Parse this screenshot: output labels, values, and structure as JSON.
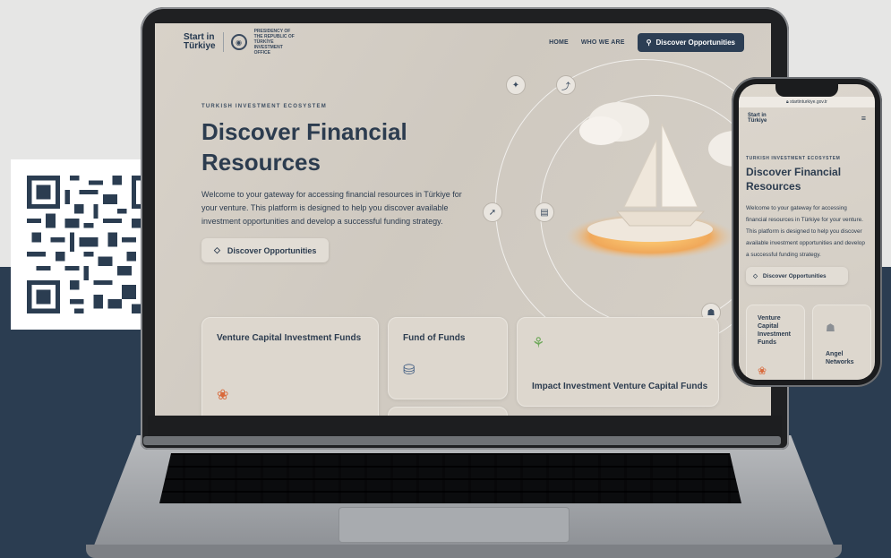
{
  "laptop_site": {
    "nav": {
      "logo_line1": "Start in",
      "logo_line2": "Türkiye",
      "office_line1": "PRESIDENCY OF THE REPUBLIC OF TÜRKİYE",
      "office_line2": "INVESTMENT OFFICE",
      "links": [
        "HOME",
        "WHO WE ARE"
      ],
      "cta_label": "Discover Opportunities"
    },
    "hero": {
      "eyebrow": "TURKISH INVESTMENT ECOSYSTEM",
      "title": "Discover Financial Resources",
      "description": "Welcome to your gateway for accessing financial resources in Türkiye for your venture. This platform is designed to help you discover available investment opportunities and develop a successful funding strategy.",
      "button_label": "Discover Opportunities"
    },
    "cards": [
      {
        "title": "Venture Capital Investment Funds",
        "icon": "handshake-icon"
      },
      {
        "title": "Fund of Funds",
        "icon": "coins-hand-icon"
      },
      {
        "title": "Impact Investment Venture Capital Funds",
        "icon": "sprout-icon"
      }
    ]
  },
  "phone_site": {
    "url": "startinturkiye.gov.tr",
    "logo_line1": "Start in",
    "logo_line2": "Türkiye",
    "eyebrow": "TURKISH INVESTMENT ECOSYSTEM",
    "title": "Discover Financial Resources",
    "description": "Welcome to your gateway for accessing financial resources in Türkiye for your venture. This platform is designed to help you discover available investment opportunities and develop a successful funding strategy.",
    "button_label": "Discover Opportunities",
    "cards": [
      {
        "title": "Venture Capital Investment Funds"
      },
      {
        "title": "Angel Networks"
      }
    ]
  },
  "colors": {
    "navy": "#2c3e54",
    "page_bg_dark": "#2b3d51",
    "page_bg_light": "#e6e6e5",
    "accent_orange": "#d96a3c"
  }
}
